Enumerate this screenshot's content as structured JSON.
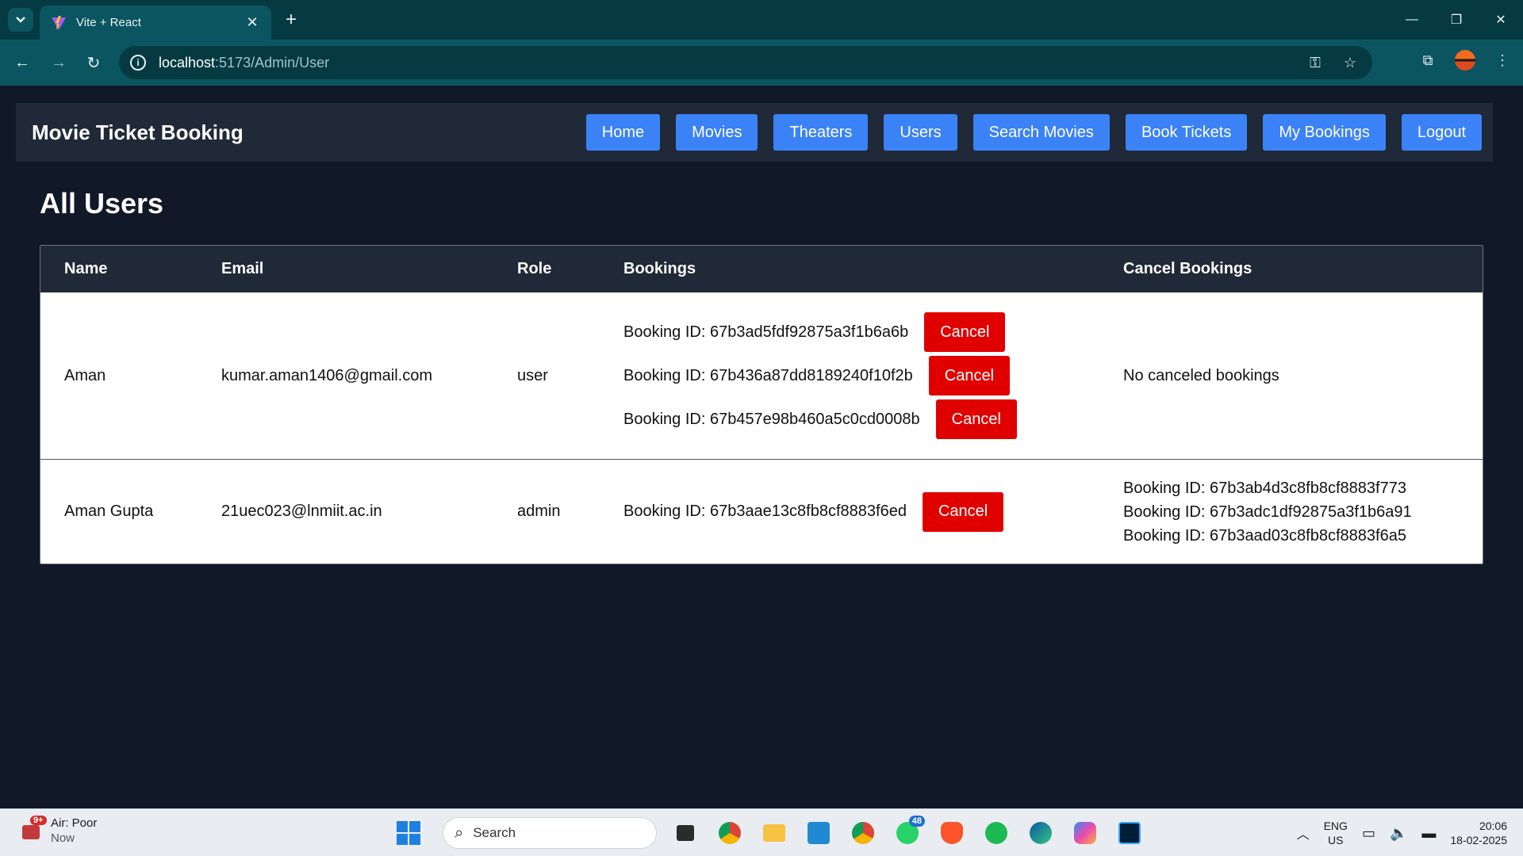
{
  "browser": {
    "tab_title": "Vite + React",
    "url_host": "localhost",
    "url_path": ":5173/Admin/User"
  },
  "navbar": {
    "brand": "Movie Ticket Booking",
    "links": [
      "Home",
      "Movies",
      "Theaters",
      "Users",
      "Search Movies",
      "Book Tickets",
      "My Bookings",
      "Logout"
    ]
  },
  "page_title": "All Users",
  "table": {
    "headers": [
      "Name",
      "Email",
      "Role",
      "Bookings",
      "Cancel Bookings"
    ],
    "cancel_label": "Cancel",
    "rows": [
      {
        "name": "Aman",
        "email": "kumar.aman1406@gmail.com",
        "role": "user",
        "bookings": [
          "Booking ID: 67b3ad5fdf92875a3f1b6a6b",
          "Booking ID: 67b436a87dd8189240f10f2b",
          "Booking ID: 67b457e98b460a5c0cd0008b"
        ],
        "canceled_text": "No canceled bookings"
      },
      {
        "name": "Aman Gupta",
        "email": "21uec023@lnmiit.ac.in",
        "role": "admin",
        "bookings": [
          "Booking ID: 67b3aae13c8fb8cf8883f6ed"
        ],
        "canceled": [
          "Booking ID: 67b3ab4d3c8fb8cf8883f773",
          "Booking ID: 67b3adc1df92875a3f1b6a91",
          "Booking ID: 67b3aad03c8fb8cf8883f6a5"
        ]
      }
    ]
  },
  "taskbar": {
    "weather_badge": "9+",
    "weather_title": "Air: Poor",
    "weather_sub": "Now",
    "search_label": "Search",
    "whatsapp_badge": "48",
    "lang_1": "ENG",
    "lang_2": "US",
    "time": "20:06",
    "date": "18-02-2025"
  },
  "colors": {
    "page_bg": "#111827",
    "navbar_bg": "#1f2937",
    "nav_button": "#3b82f6",
    "cancel_button": "#e00000"
  }
}
